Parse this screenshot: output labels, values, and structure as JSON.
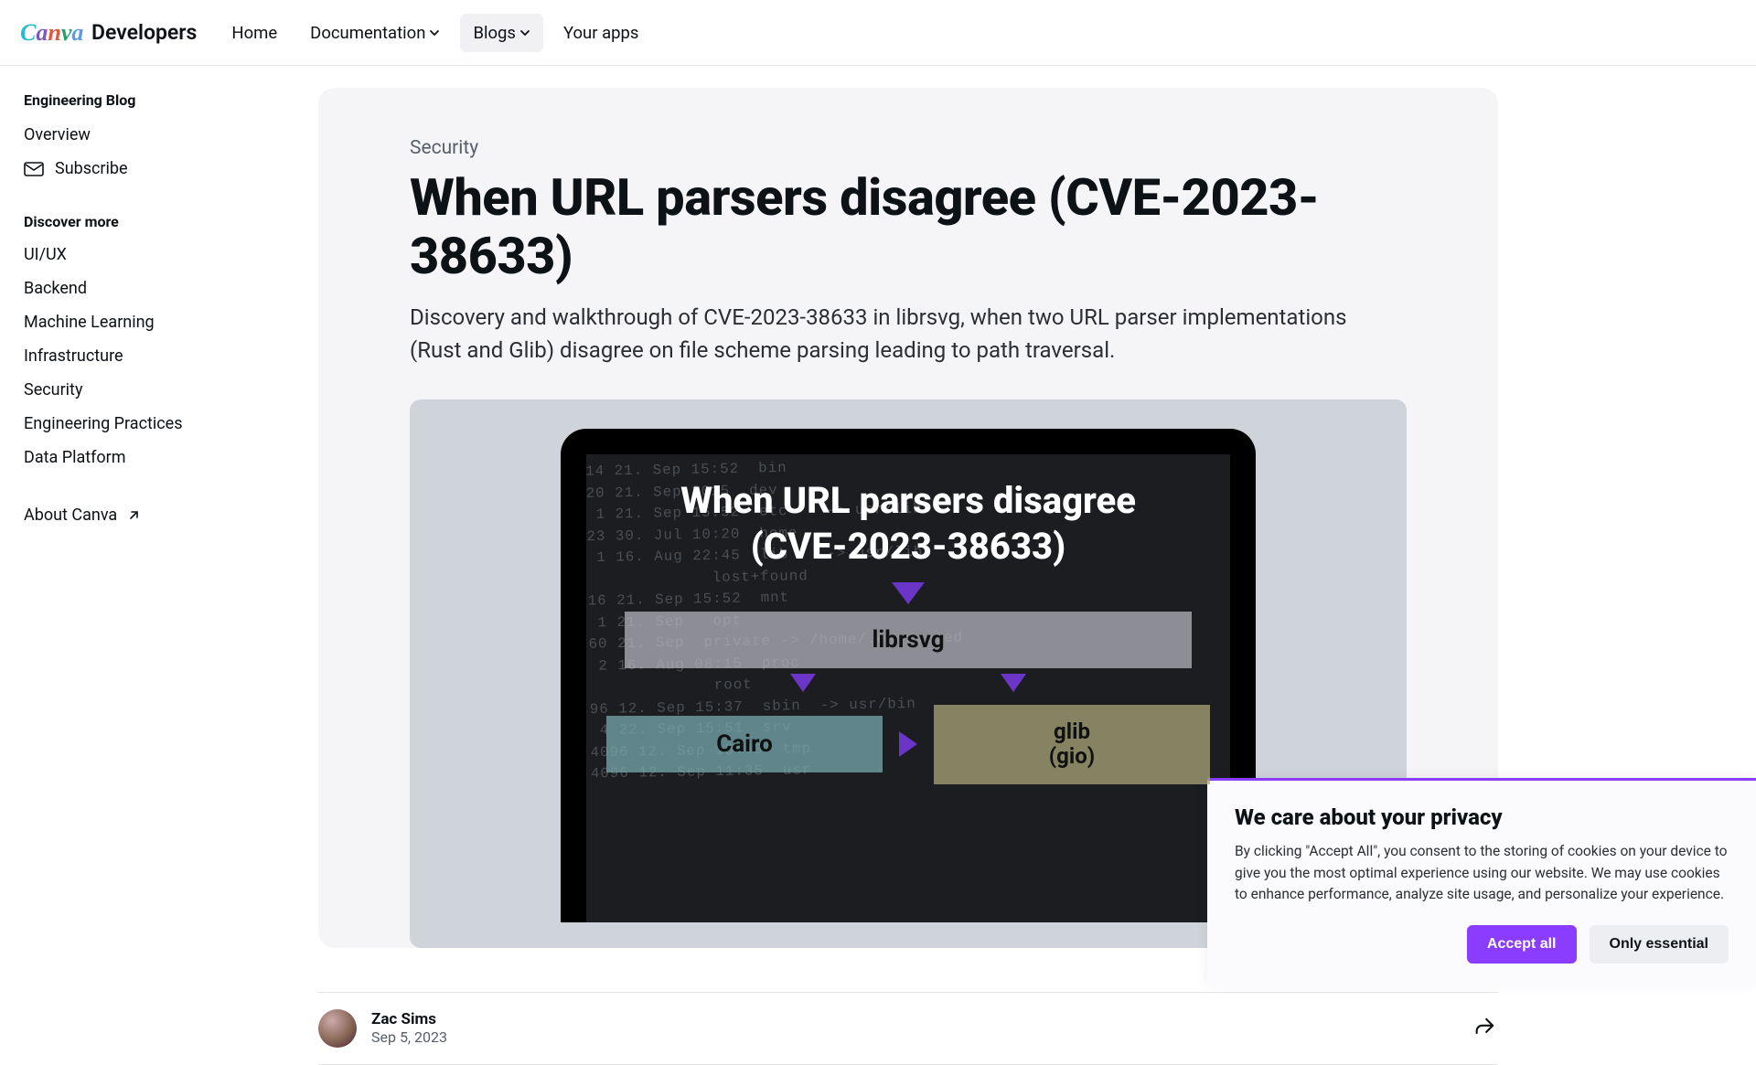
{
  "brand": {
    "name": "Canva",
    "suffix": "Developers"
  },
  "nav": {
    "home": "Home",
    "documentation": "Documentation",
    "blogs": "Blogs",
    "your_apps": "Your apps"
  },
  "sidebar": {
    "heading": "Engineering Blog",
    "overview": "Overview",
    "subscribe": "Subscribe",
    "discover_heading": "Discover more",
    "categories": [
      "UI/UX",
      "Backend",
      "Machine Learning",
      "Infrastructure",
      "Security",
      "Engineering Practices",
      "Data Platform"
    ],
    "about": "About Canva"
  },
  "article": {
    "category": "Security",
    "title": "When URL parsers disagree (CVE-2023-38633)",
    "excerpt": "Discovery and walkthrough of CVE-2023-38633 in librsvg, when two URL parser implementations (Rust and Glib) disagree on file scheme parsing leading to path traversal.",
    "hero": {
      "headline_l1": "When URL parsers disagree",
      "headline_l2": "(CVE-2023-38633)",
      "box_top": "librsvg",
      "box_left": "Cairo",
      "box_right_l1": "glib",
      "box_right_l2": "(gio)"
    },
    "author": {
      "name": "Zac Sims",
      "date": "Sep 5, 2023"
    }
  },
  "cookie": {
    "title": "We care about your privacy",
    "text": "By clicking \"Accept All\", you consent to the storing of cookies on your device to give you the most optimal experience using our website. We may use cookies to enhance performance, analyze site usage, and personalize your experience.",
    "accept": "Accept all",
    "essential": "Only essential"
  }
}
